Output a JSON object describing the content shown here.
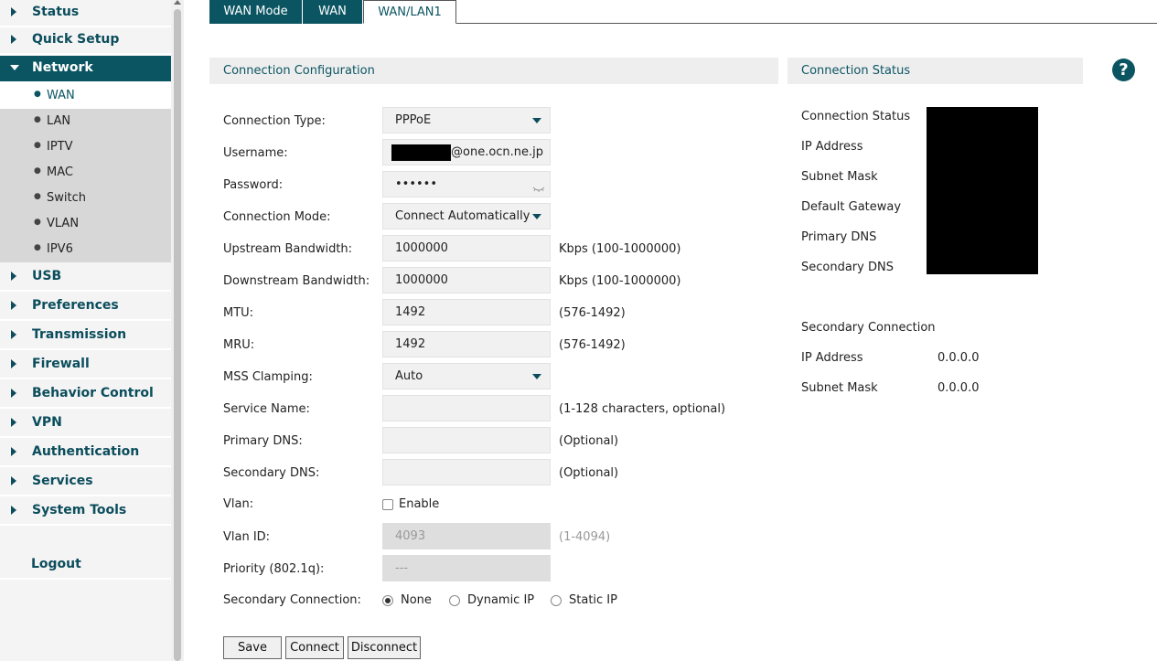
{
  "sidebar": {
    "items": [
      {
        "label": "Status"
      },
      {
        "label": "Quick Setup"
      },
      {
        "label": "Network"
      },
      {
        "label": "USB"
      },
      {
        "label": "Preferences"
      },
      {
        "label": "Transmission"
      },
      {
        "label": "Firewall"
      },
      {
        "label": "Behavior Control"
      },
      {
        "label": "VPN"
      },
      {
        "label": "Authentication"
      },
      {
        "label": "Services"
      },
      {
        "label": "System Tools"
      }
    ],
    "network_sub": [
      {
        "label": "WAN"
      },
      {
        "label": "LAN"
      },
      {
        "label": "IPTV"
      },
      {
        "label": "MAC"
      },
      {
        "label": "Switch"
      },
      {
        "label": "VLAN"
      },
      {
        "label": "IPV6"
      }
    ],
    "logout": "Logout"
  },
  "tabs": [
    {
      "label": "WAN Mode"
    },
    {
      "label": "WAN"
    },
    {
      "label": "WAN/LAN1"
    }
  ],
  "config": {
    "header": "Connection Configuration",
    "connection_type": {
      "label": "Connection Type:",
      "value": "PPPoE"
    },
    "username": {
      "label": "Username:",
      "value_suffix": "@one.ocn.ne.jp"
    },
    "password": {
      "label": "Password:",
      "value": "••••••"
    },
    "connection_mode": {
      "label": "Connection Mode:",
      "value": "Connect Automatically"
    },
    "upstream": {
      "label": "Upstream Bandwidth:",
      "value": "1000000",
      "hint": "Kbps (100-1000000)"
    },
    "downstream": {
      "label": "Downstream Bandwidth:",
      "value": "1000000",
      "hint": "Kbps (100-1000000)"
    },
    "mtu": {
      "label": "MTU:",
      "value": "1492",
      "hint": "(576-1492)"
    },
    "mru": {
      "label": "MRU:",
      "value": "1492",
      "hint": "(576-1492)"
    },
    "mss": {
      "label": "MSS Clamping:",
      "value": "Auto"
    },
    "service_name": {
      "label": "Service Name:",
      "value": "",
      "hint": "(1-128 characters, optional)"
    },
    "primary_dns": {
      "label": "Primary DNS:",
      "value": "",
      "hint": "(Optional)"
    },
    "secondary_dns": {
      "label": "Secondary DNS:",
      "value": "",
      "hint": "(Optional)"
    },
    "vlan": {
      "label": "Vlan:",
      "enable_label": "Enable",
      "checked": false
    },
    "vlan_id": {
      "label": "Vlan ID:",
      "value": "4093",
      "hint": "(1-4094)"
    },
    "priority": {
      "label": "Priority (802.1q):",
      "value": "---"
    },
    "secondary_connection": {
      "label": "Secondary Connection:",
      "options": [
        "None",
        "Dynamic IP",
        "Static IP"
      ],
      "selected": "None"
    },
    "buttons": {
      "save": "Save",
      "connect": "Connect",
      "disconnect": "Disconnect"
    }
  },
  "status": {
    "header": "Connection Status",
    "labels": [
      "Connection Status",
      "IP Address",
      "Subnet Mask",
      "Default Gateway",
      "Primary DNS",
      "Secondary DNS"
    ],
    "secondary": {
      "title": "Secondary Connection",
      "ip_label": "IP Address",
      "ip_value": "0.0.0.0",
      "mask_label": "Subnet Mask",
      "mask_value": "0.0.0.0"
    }
  },
  "help_icon": "question-icon",
  "colors": {
    "accent": "#0b5563",
    "panel_header": "#eeeeee"
  }
}
